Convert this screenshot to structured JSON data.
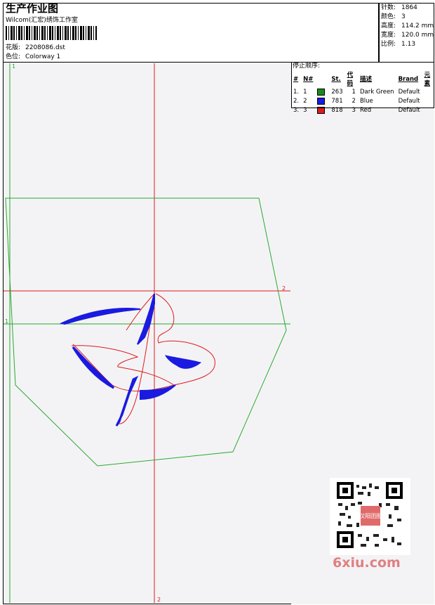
{
  "header": {
    "title": "生产作业图",
    "studio": "Wilcom(汇宏)绣饰工作室",
    "design_label": "花版:",
    "design_value": "2208086.dst",
    "colorway_label": "色位:",
    "colorway_value": "Colorway 1"
  },
  "stats": [
    {
      "label": "针数:",
      "value": "1864"
    },
    {
      "label": "颜色:",
      "value": "3"
    },
    {
      "label": "高度:",
      "value": "114.2 mm"
    },
    {
      "label": "宽度:",
      "value": "120.0 mm"
    },
    {
      "label": "比例:",
      "value": "1.13"
    }
  ],
  "stop_sequence": {
    "title": "停止顺序:",
    "columns": [
      "#",
      "N#",
      "St.",
      "代码",
      "描述",
      "Brand",
      "元素"
    ],
    "rows": [
      {
        "num": "1.",
        "n": "1",
        "color": "#1a8a1a",
        "st": "263",
        "code": "1",
        "desc": "Dark Green",
        "brand": "Default"
      },
      {
        "num": "2.",
        "n": "2",
        "color": "#1a1ae0",
        "st": "781",
        "code": "2",
        "desc": "Blue",
        "brand": "Default"
      },
      {
        "num": "3.",
        "n": "3",
        "color": "#e01a1a",
        "st": "818",
        "code": "3",
        "desc": "Red",
        "brand": "Default"
      }
    ]
  },
  "markers": {
    "green_top": "1",
    "green_left": "1",
    "red_right": "2",
    "red_bottom": "2"
  },
  "watermark": "6xiu.com",
  "qr_label": "汉阳团图"
}
